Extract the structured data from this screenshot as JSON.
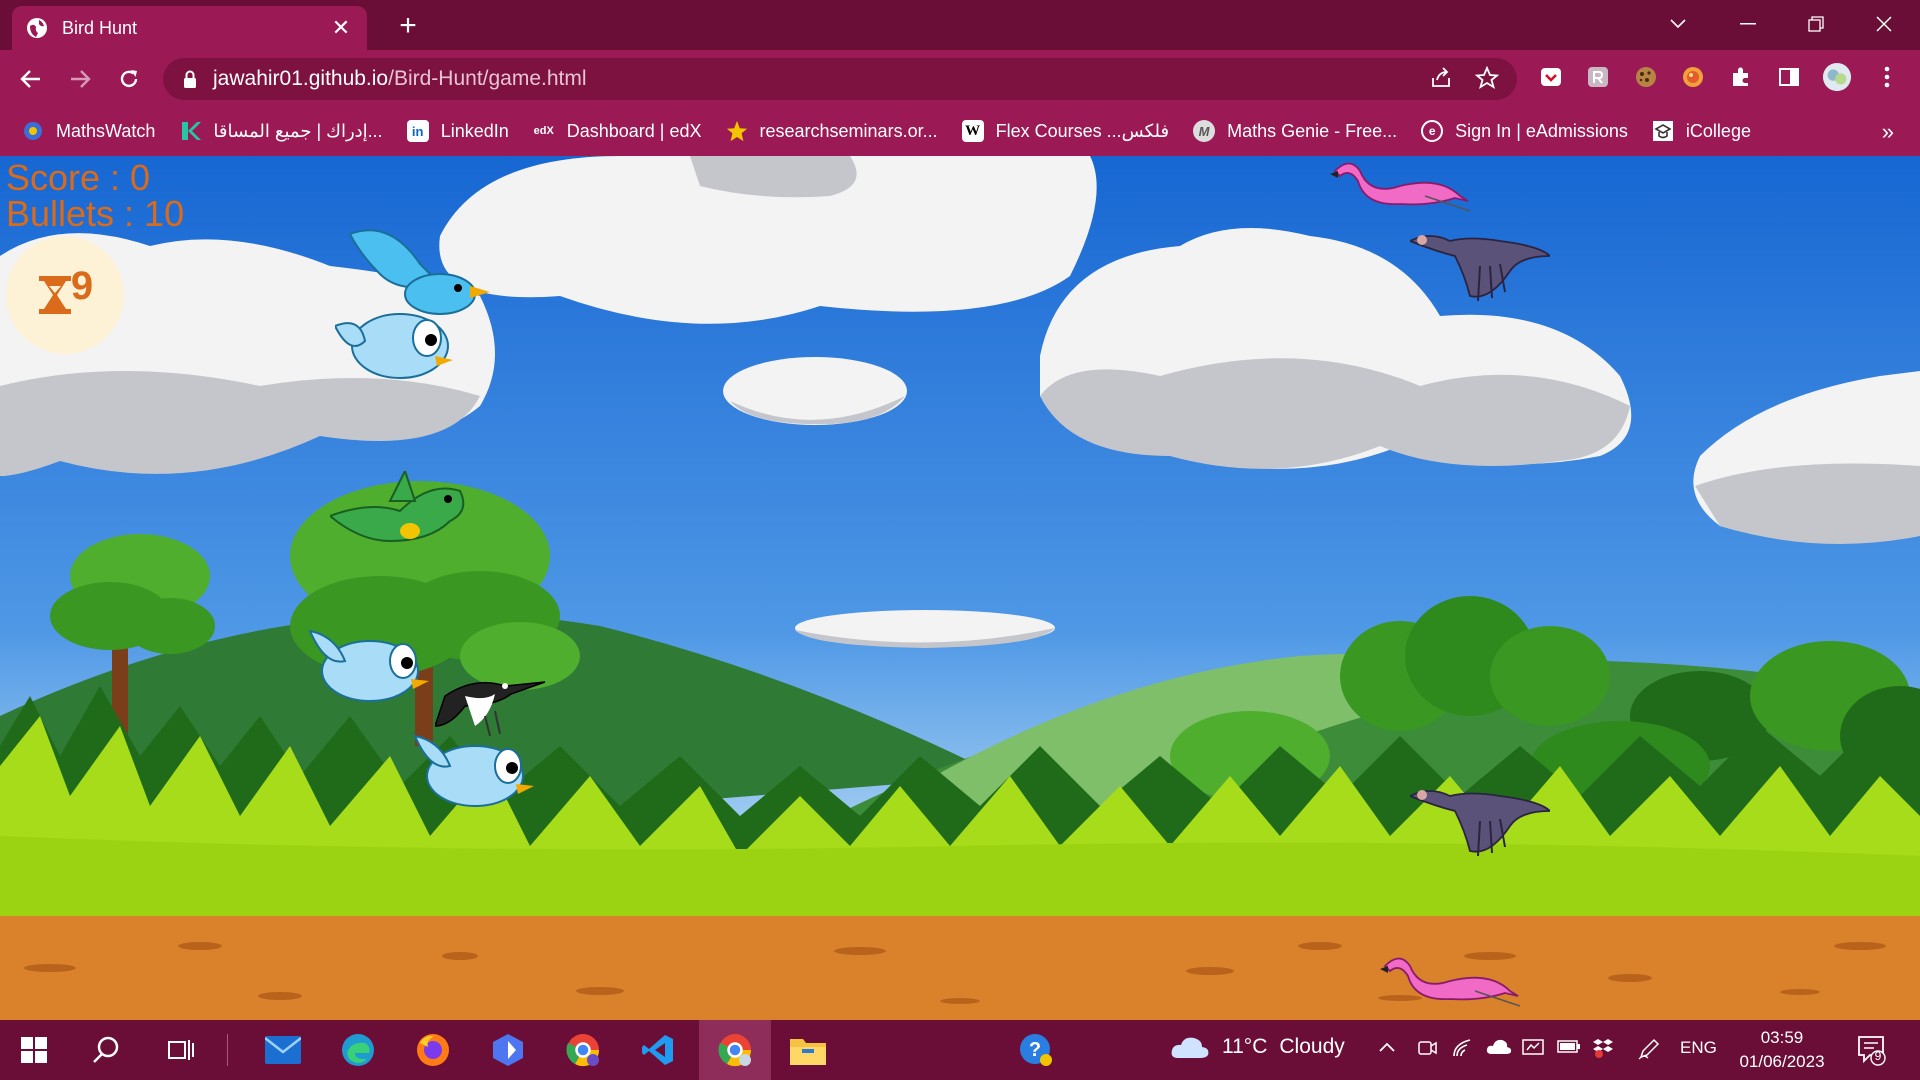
{
  "browser": {
    "tab_title": "Bird Hunt",
    "tab_close": "✕",
    "new_tab": "+",
    "url_host": "jawahir01.github.io",
    "url_path": "/Bird-Hunt/game.html",
    "bookmarks": [
      {
        "label": "MathsWatch",
        "icon": "mathswatch-icon"
      },
      {
        "label": "إدراك | جميع المساقا...",
        "icon": "edraak-icon"
      },
      {
        "label": "LinkedIn",
        "icon": "linkedin-icon"
      },
      {
        "label": "Dashboard | edX",
        "icon": "edx-icon"
      },
      {
        "label": "researchseminars.or...",
        "icon": "star-icon"
      },
      {
        "label": "Flex Courses ...فلكس",
        "icon": "wikipedia-icon"
      },
      {
        "label": "Maths Genie - Free...",
        "icon": "mathsgenie-icon"
      },
      {
        "label": "Sign In | eAdmissions",
        "icon": "eadmissions-icon"
      },
      {
        "label": "iCollege",
        "icon": "icollege-icon"
      }
    ],
    "bookmarks_more": "»"
  },
  "game": {
    "score_text": "Score : 0",
    "bullets_text": "Bullets : 10",
    "timer_value": "9",
    "hud_color": "#d96b1a"
  },
  "taskbar": {
    "weather_temp": "11°C",
    "weather_desc": "Cloudy",
    "language": "ENG",
    "time": "03:59",
    "date": "01/06/2023",
    "notifications": "9"
  },
  "colors": {
    "chrome_dark": "#6b0e37",
    "chrome_main": "#9b1a55",
    "sky": "#1f74d6",
    "grass": "#a6dc1a",
    "dirt": "#d9822b"
  }
}
